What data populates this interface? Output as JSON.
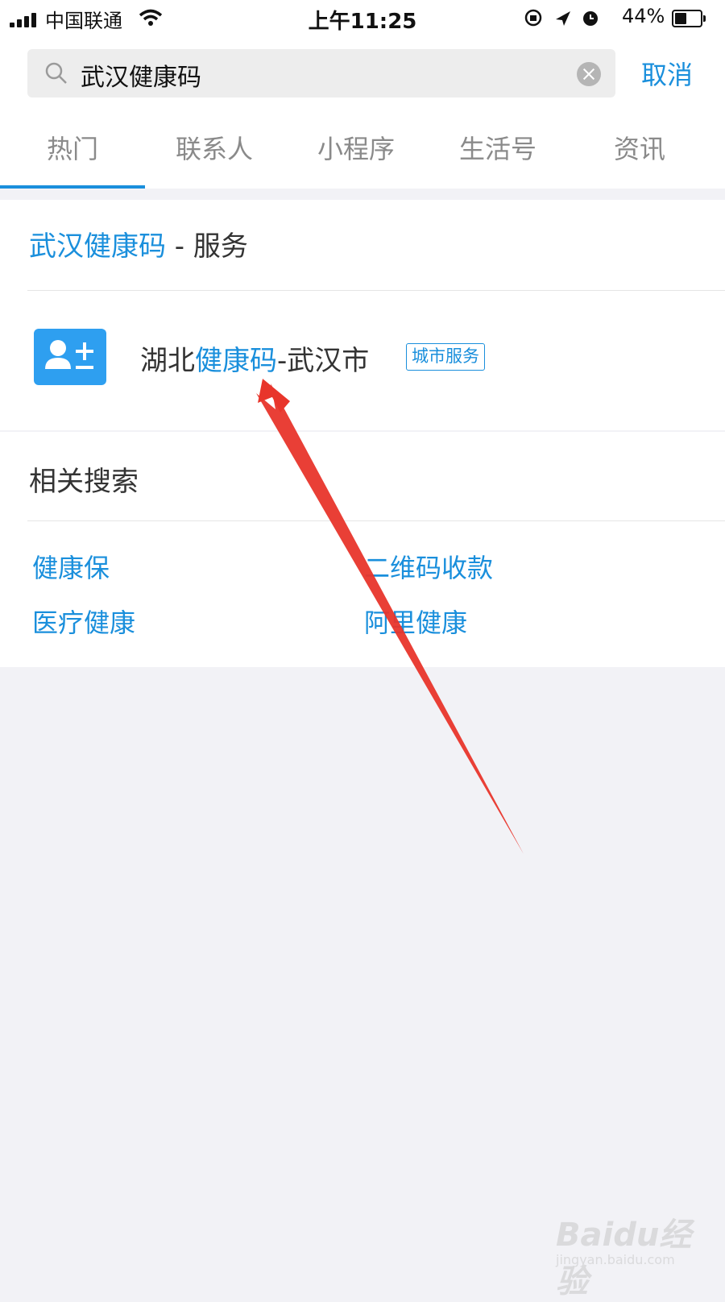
{
  "status_bar": {
    "carrier": "中国联通",
    "time": "上午11:25",
    "battery": "44%"
  },
  "search": {
    "query": "武汉健康码",
    "cancel_label": "取消",
    "search_icon": "search-icon",
    "clear_icon": "clear-icon"
  },
  "tabs": [
    {
      "label": "热门",
      "active": true
    },
    {
      "label": "联系人"
    },
    {
      "label": "小程序"
    },
    {
      "label": "生活号"
    },
    {
      "label": "资讯"
    }
  ],
  "service_section": {
    "keyword": "武汉健康码",
    "suffix": " - 服务",
    "result": {
      "prefix": "湖北",
      "highlight": "健康码",
      "suffix": "-武汉市",
      "tag": "城市服务",
      "icon": "add-contact-icon"
    }
  },
  "related_section": {
    "title": "相关搜索",
    "items": [
      "健康保",
      "二维码收款",
      "医疗健康",
      "阿里健康"
    ]
  },
  "annotation": {
    "arrow_color": "#e8352b"
  },
  "watermark": {
    "main": "Baidu经验",
    "sub": "jingyan.baidu.com"
  },
  "colors": {
    "accent": "#1a8fdc",
    "background": "#f2f2f6",
    "icon_bg": "#2e9ff0"
  }
}
